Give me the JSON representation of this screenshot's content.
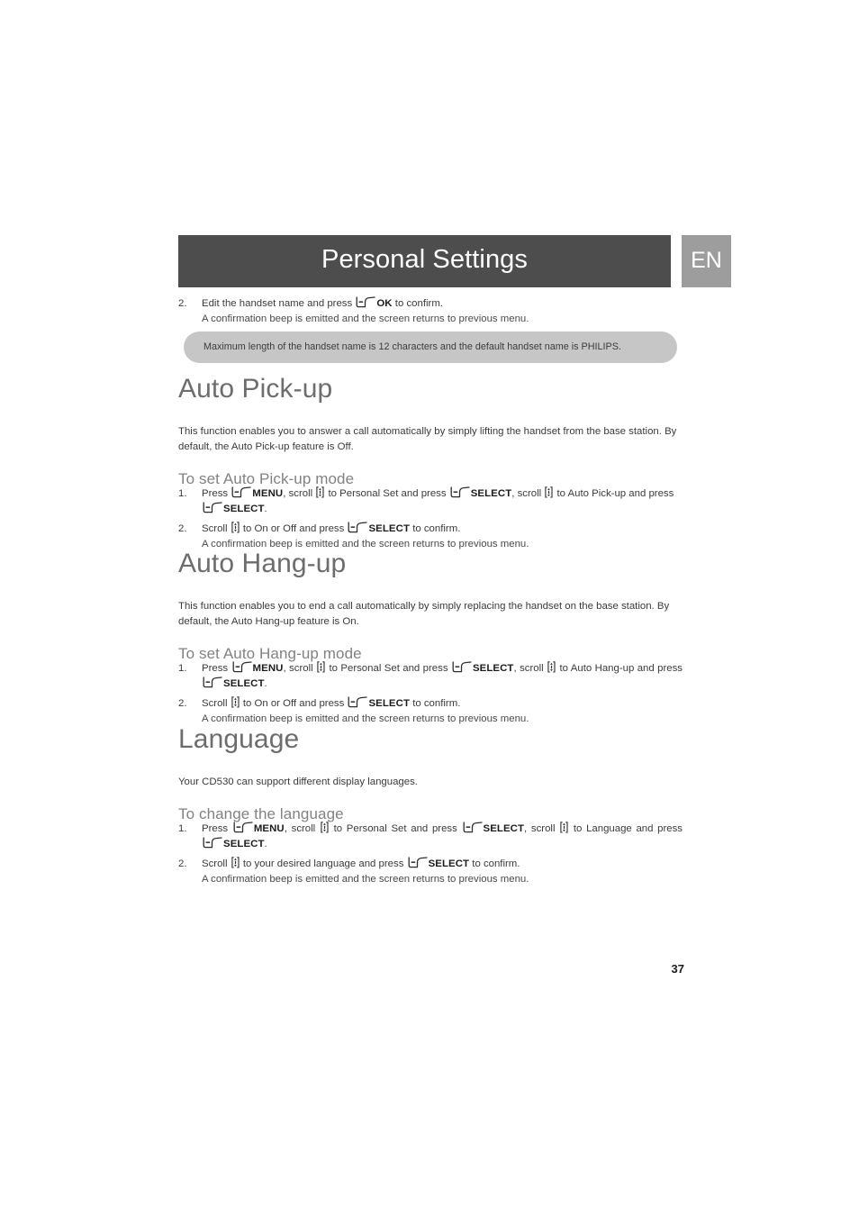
{
  "header": {
    "title": "Personal Settings",
    "language_badge": "EN",
    "bar_color": "#4d4d4d",
    "badge_color": "#9d9d9d"
  },
  "intro_step": {
    "number": "2.",
    "text_before_icon": "Edit the handset name and press ",
    "icon": "softkey-icon",
    "bold_label": "OK",
    "text_after": " to confirm.",
    "sub_text": "A confirmation beep is emitted and the screen returns to previous menu."
  },
  "note": {
    "text": "Maximum length of the handset name is 12 characters and the default handset name is PHILIPS.",
    "bg_color": "#c6c6c6"
  },
  "sections": [
    {
      "heading": "Auto Pick-up",
      "intro": "This function enables you to answer a call automatically by simply lifting the handset from the base station. By default, the Auto Pick-up feature is Off.",
      "subheading": "To set Auto Pick-up mode",
      "steps": [
        {
          "number": "1.",
          "parts": [
            {
              "t": "text",
              "v": "Press "
            },
            {
              "t": "icon",
              "v": "softkey-icon"
            },
            {
              "t": "bold",
              "v": "MENU"
            },
            {
              "t": "text",
              "v": ", scroll "
            },
            {
              "t": "icon",
              "v": "scroll-icon"
            },
            {
              "t": "text",
              "v": " to Personal Set and press "
            },
            {
              "t": "icon",
              "v": "softkey-icon"
            },
            {
              "t": "bold",
              "v": "SELECT"
            },
            {
              "t": "text",
              "v": ", scroll "
            },
            {
              "t": "icon",
              "v": "scroll-icon"
            },
            {
              "t": "text",
              "v": " to Auto Pick-up and press "
            },
            {
              "t": "icon",
              "v": "softkey-icon"
            },
            {
              "t": "bold",
              "v": "SELECT"
            },
            {
              "t": "text",
              "v": "."
            }
          ],
          "sub": ""
        },
        {
          "number": "2.",
          "parts": [
            {
              "t": "text",
              "v": "Scroll "
            },
            {
              "t": "icon",
              "v": "scroll-icon"
            },
            {
              "t": "text",
              "v": " to On or Off and press "
            },
            {
              "t": "icon",
              "v": "softkey-icon"
            },
            {
              "t": "bold",
              "v": "SELECT"
            },
            {
              "t": "text",
              "v": " to confirm."
            }
          ],
          "sub": "A confirmation beep is emitted and the screen returns to previous menu."
        }
      ]
    },
    {
      "heading": "Auto Hang-up",
      "intro": "This function enables you to end a call automatically by simply replacing the handset on the base station. By default, the Auto Hang-up feature is On.",
      "subheading": "To set Auto Hang-up mode",
      "steps": [
        {
          "number": "1.",
          "parts": [
            {
              "t": "text",
              "v": "Press "
            },
            {
              "t": "icon",
              "v": "softkey-icon"
            },
            {
              "t": "bold",
              "v": "MENU"
            },
            {
              "t": "text",
              "v": ", scroll "
            },
            {
              "t": "icon",
              "v": "scroll-icon"
            },
            {
              "t": "text",
              "v": " to Personal Set and press "
            },
            {
              "t": "icon",
              "v": "softkey-icon"
            },
            {
              "t": "bold",
              "v": "SELECT"
            },
            {
              "t": "text",
              "v": ", scroll "
            },
            {
              "t": "icon",
              "v": "scroll-icon"
            },
            {
              "t": "text",
              "v": " to Auto Hang-up and press "
            },
            {
              "t": "icon",
              "v": "softkey-icon"
            },
            {
              "t": "bold",
              "v": "SELECT"
            },
            {
              "t": "text",
              "v": "."
            }
          ],
          "sub": ""
        },
        {
          "number": "2.",
          "parts": [
            {
              "t": "text",
              "v": "Scroll "
            },
            {
              "t": "icon",
              "v": "scroll-icon"
            },
            {
              "t": "text",
              "v": " to On or Off and press "
            },
            {
              "t": "icon",
              "v": "softkey-icon"
            },
            {
              "t": "bold",
              "v": "SELECT"
            },
            {
              "t": "text",
              "v": " to confirm."
            }
          ],
          "sub": "A confirmation beep is emitted and the screen returns to previous menu."
        }
      ]
    },
    {
      "heading": "Language",
      "intro": "Your CD530 can support different display languages.",
      "subheading": "To change the language",
      "steps": [
        {
          "number": "1.",
          "parts": [
            {
              "t": "text",
              "v": "Press "
            },
            {
              "t": "icon",
              "v": "softkey-icon"
            },
            {
              "t": "bold",
              "v": "MENU"
            },
            {
              "t": "text",
              "v": ", scroll "
            },
            {
              "t": "icon",
              "v": "scroll-icon"
            },
            {
              "t": "text",
              "v": " to Personal Set and press "
            },
            {
              "t": "icon",
              "v": "softkey-icon"
            },
            {
              "t": "bold",
              "v": "SELECT"
            },
            {
              "t": "text",
              "v": ", scroll "
            },
            {
              "t": "icon",
              "v": "scroll-icon"
            },
            {
              "t": "text",
              "v": " to Language and press "
            },
            {
              "t": "icon",
              "v": "softkey-icon"
            },
            {
              "t": "bold",
              "v": "SELECT"
            },
            {
              "t": "text",
              "v": "."
            }
          ],
          "sub": ""
        },
        {
          "number": "2.",
          "parts": [
            {
              "t": "text",
              "v": "Scroll "
            },
            {
              "t": "icon",
              "v": "scroll-icon"
            },
            {
              "t": "text",
              "v": " to your desired language and press "
            },
            {
              "t": "icon",
              "v": "softkey-icon"
            },
            {
              "t": "bold",
              "v": "SELECT"
            },
            {
              "t": "text",
              "v": " to confirm."
            }
          ],
          "sub": "A confirmation beep is emitted and the screen returns to previous menu."
        }
      ]
    }
  ],
  "footer": {
    "page_number": "37"
  }
}
